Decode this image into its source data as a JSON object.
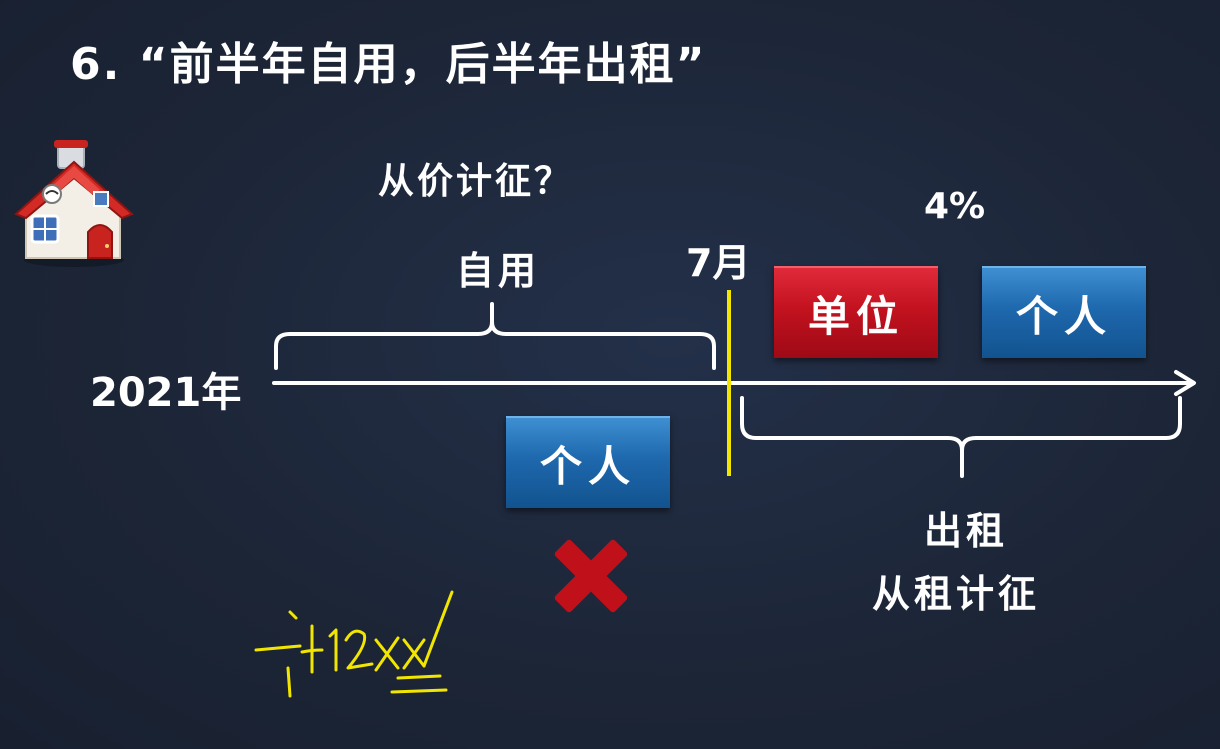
{
  "title": "6. “前半年自用，后半年出租”",
  "question": "从价计征？",
  "self_use_label": "自用",
  "july_label": "7月",
  "rate_label": "4%",
  "year_label": "2021年",
  "box_unit_label": "单位",
  "box_individual_top_label": "个人",
  "box_individual_mid_label": "个人",
  "rent_label": "出租",
  "rent_basis_label": "从租计征",
  "handwriting_text": "计12XX",
  "colors": {
    "background": "#1c2536",
    "timeline": "#ffffff",
    "divider": "#f2e600",
    "cross": "#c0111b",
    "box_blue": "#1e68ad",
    "box_red": "#c3121f",
    "handwriting": "#f2e600"
  },
  "icons": [
    "house-icon",
    "cross-icon"
  ]
}
